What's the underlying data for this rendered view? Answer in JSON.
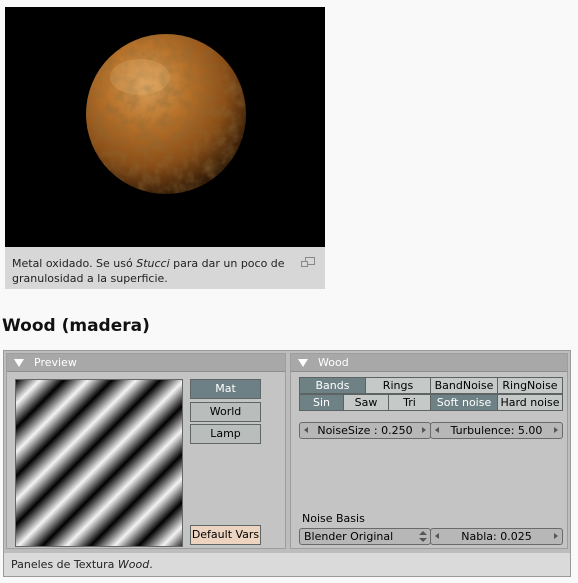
{
  "figure": {
    "caption_before": "Metal oxidado. Se usó ",
    "caption_emph": "Stucci",
    "caption_after": " para dar un poco de granulosidad a la superficie.",
    "icon": "enlarge-icon"
  },
  "section": {
    "heading": "Wood (madera)"
  },
  "preview_panel": {
    "title": "Preview",
    "buttons": [
      "Mat",
      "World",
      "Lamp"
    ],
    "active_button": "Mat",
    "default_vars": "Default Vars"
  },
  "wood_panel": {
    "title": "Wood",
    "row1": [
      "Bands",
      "Rings",
      "BandNoise",
      "RingNoise"
    ],
    "row2": [
      "Sin",
      "Saw",
      "Tri",
      "Soft noise",
      "Hard noise"
    ],
    "noisesize": "NoiseSize : 0.250",
    "turbulence": "Turbulence: 5.00",
    "noise_basis_label": "Noise Basis",
    "noise_basis_value": "Blender Original",
    "nabla": "Nabla: 0.025"
  },
  "screenshot_caption": {
    "before": "Paneles de Textura ",
    "emph": "Wood",
    "after": "."
  },
  "colors": {
    "active_button": "#6d8085",
    "rust": "#a45d1c"
  }
}
